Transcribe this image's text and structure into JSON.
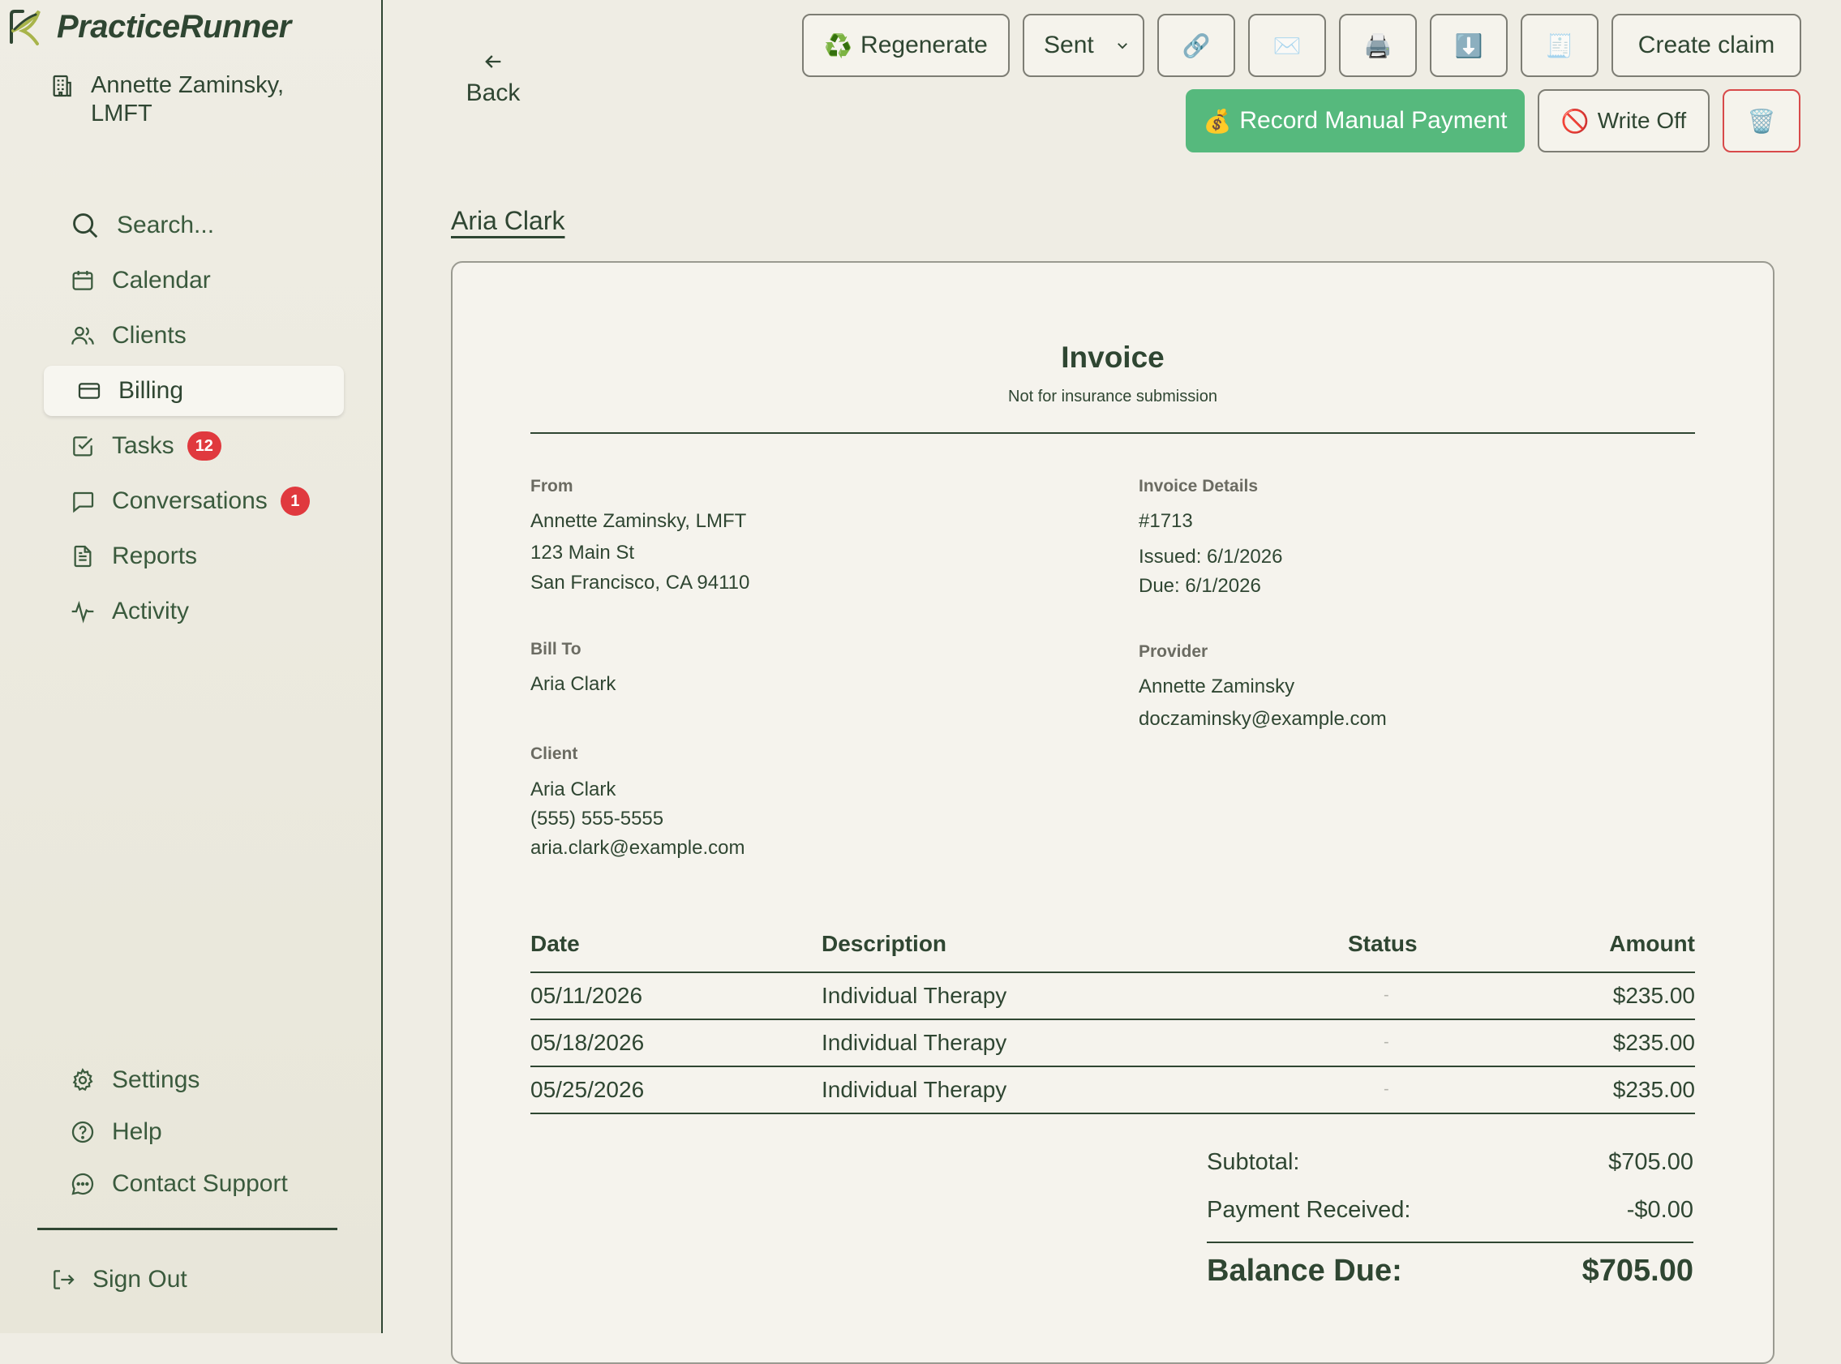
{
  "brand": {
    "name": "PracticeRunner"
  },
  "practice": {
    "name_line1": "Annette Zaminsky,",
    "name_line2": "LMFT"
  },
  "nav": {
    "search": "Search...",
    "calendar": "Calendar",
    "clients": "Clients",
    "billing": "Billing",
    "tasks": "Tasks",
    "tasks_badge": "12",
    "conversations": "Conversations",
    "conversations_badge": "1",
    "reports": "Reports",
    "activity": "Activity",
    "settings": "Settings",
    "help": "Help",
    "contact_support": "Contact Support",
    "sign_out": "Sign Out"
  },
  "toolbar": {
    "back": "Back",
    "regenerate": "Regenerate",
    "regenerate_emoji": "♻️",
    "status_selected": "Sent",
    "link_emoji": "🔗",
    "email_emoji": "✉️",
    "print_emoji": "🖨️",
    "download_emoji": "⬇️",
    "receipt_emoji": "🧾",
    "create_claim": "Create claim",
    "record_payment": "Record Manual Payment",
    "record_payment_emoji": "💰",
    "write_off": "Write Off",
    "write_off_emoji": "🚫",
    "delete_emoji": "🗑️"
  },
  "client_link": "Aria Clark",
  "invoice": {
    "title": "Invoice",
    "subtitle": "Not for insurance submission",
    "from": {
      "label": "From",
      "name": "Annette Zaminsky, LMFT",
      "address1": "123 Main St",
      "address2": "San Francisco, CA 94110"
    },
    "details": {
      "label": "Invoice Details",
      "number": "#1713",
      "issued": "Issued: 6/1/2026",
      "due": "Due: 6/1/2026"
    },
    "bill_to": {
      "label": "Bill To",
      "name": "Aria Clark"
    },
    "provider": {
      "label": "Provider",
      "name": "Annette Zaminsky",
      "email": "doczaminsky@example.com"
    },
    "client": {
      "label": "Client",
      "name": "Aria Clark",
      "phone": "(555) 555-5555",
      "email": "aria.clark@example.com"
    },
    "table": {
      "headers": {
        "date": "Date",
        "description": "Description",
        "status": "Status",
        "amount": "Amount"
      },
      "rows": [
        {
          "date": "05/11/2026",
          "description": "Individual Therapy",
          "status": "-",
          "amount": "$235.00"
        },
        {
          "date": "05/18/2026",
          "description": "Individual Therapy",
          "status": "-",
          "amount": "$235.00"
        },
        {
          "date": "05/25/2026",
          "description": "Individual Therapy",
          "status": "-",
          "amount": "$235.00"
        }
      ]
    },
    "totals": {
      "subtotal_label": "Subtotal:",
      "subtotal": "$705.00",
      "payment_label": "Payment Received:",
      "payment": "-$0.00",
      "balance_label": "Balance Due:",
      "balance": "$705.00"
    }
  },
  "colors": {
    "accent_green": "#56b97d",
    "text_dark_green": "#2f4632",
    "badge_red": "#e0393e",
    "danger_border": "#d84a4a"
  }
}
